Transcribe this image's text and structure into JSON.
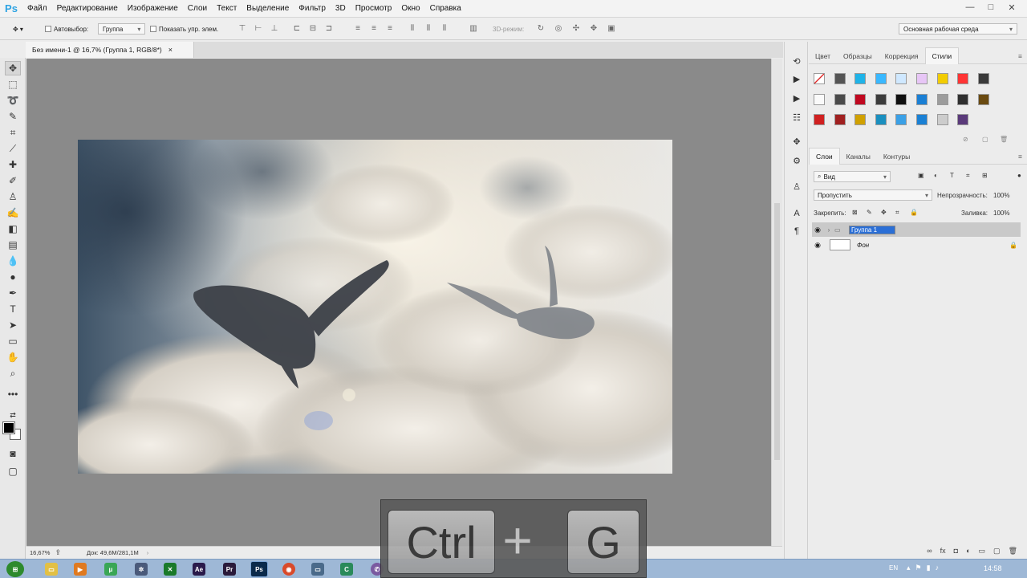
{
  "app": {
    "logo": "Ps"
  },
  "menu": [
    "Файл",
    "Редактирование",
    "Изображение",
    "Слои",
    "Текст",
    "Выделение",
    "Фильтр",
    "3D",
    "Просмотр",
    "Окно",
    "Справка"
  ],
  "window_controls": [
    "—",
    "□",
    "✕"
  ],
  "options": {
    "autoselect_label": "Автовыбор:",
    "autoselect_value": "Группа",
    "show_transform": "Показать упр. элем.",
    "mode3d": "3D-режим:",
    "workspace": "Основная рабочая среда"
  },
  "document": {
    "tab_title": "Без имени-1 @ 16,7% (Группа 1, RGB/8*)",
    "close": "×"
  },
  "status": {
    "zoom": "16,67%",
    "doc": "Док: 49,6M/281,1M"
  },
  "panel_top": {
    "tabs": [
      "Цвет",
      "Образцы",
      "Коррекция",
      "Стили"
    ],
    "active": "Стили"
  },
  "styles_colors": [
    [
      "#ffffff",
      "#555555",
      "#1fb3e8",
      "#3ab8ff",
      "#cfe8ff",
      "#e7c6f6",
      "#f2cc00",
      "#ff3434",
      "#3a3a3a"
    ],
    [
      "#fafafa",
      "#4a4a4a",
      "#c00820",
      "#3c3c3c",
      "#101010",
      "#1a7fd4",
      "#9c9c9c",
      "#2f2f2f",
      "#6a4a10"
    ],
    [
      "#d02020",
      "#a02020",
      "#d0a000",
      "#1a8fbf",
      "#3aa0e6",
      "#1a80d4",
      "#cccccc",
      "#5a3a7a"
    ]
  ],
  "layers_panel": {
    "tabs": [
      "Слои",
      "Каналы",
      "Контуры"
    ],
    "active": "Слои",
    "filter_kind": "Вид",
    "blend_mode": "Пропустить",
    "opacity_label": "Непрозрачность:",
    "opacity_value": "100%",
    "lock_label": "Закрепить:",
    "fill_label": "Заливка:",
    "fill_value": "100%",
    "layers": [
      {
        "name": "Группа 1",
        "type": "group",
        "visible": true,
        "selected": true
      },
      {
        "name": "Фон",
        "type": "background",
        "visible": true,
        "locked": true
      }
    ]
  },
  "taskbar": {
    "lang": "EN",
    "time": "14:58"
  },
  "overlay_keys": {
    "key1": "Ctrl",
    "plus": "+",
    "key2": "G"
  }
}
